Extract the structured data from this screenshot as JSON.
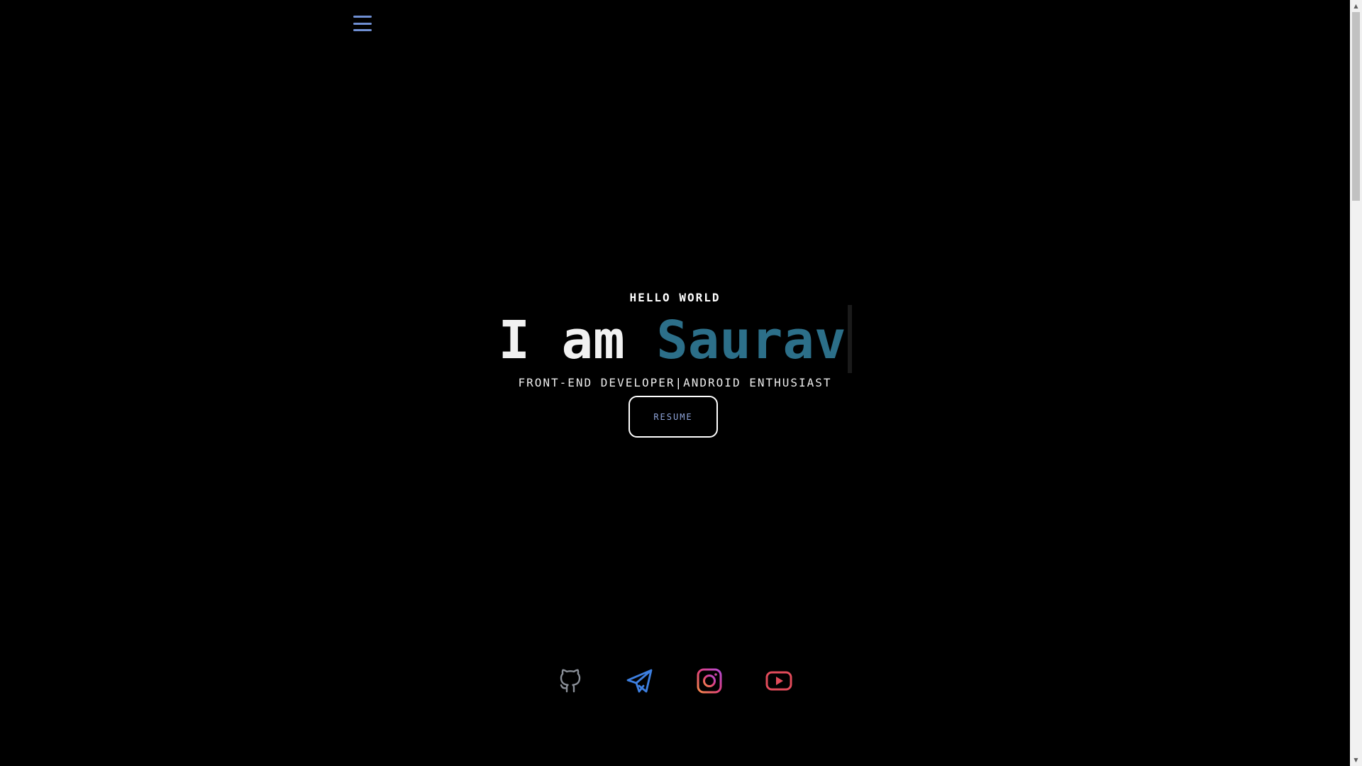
{
  "nav": {
    "menu_icon": "hamburger-menu-icon",
    "menu_color": "#6f8fd3"
  },
  "hero": {
    "greeting": "HELLO WORLD",
    "headline_prefix": "I am ",
    "headline_name": "Saurav",
    "subtitle_left": "FRONT-END DEVELOPER",
    "subtitle_separator": "|",
    "subtitle_right": "ANDROID ENTHUSIAST",
    "resume_label": "RESUME"
  },
  "colors": {
    "background": "#000000",
    "name_accent": "#2c6f89",
    "resume_text": "#8ea3d8"
  },
  "socials": [
    {
      "name": "github",
      "icon": "github-icon",
      "color": "#8a8f98"
    },
    {
      "name": "telegram",
      "icon": "telegram-icon",
      "color": "#3d7fe0"
    },
    {
      "name": "instagram",
      "icon": "instagram-icon",
      "color": "#e0407a"
    },
    {
      "name": "youtube",
      "icon": "youtube-icon",
      "color": "#e24b5a"
    }
  ]
}
